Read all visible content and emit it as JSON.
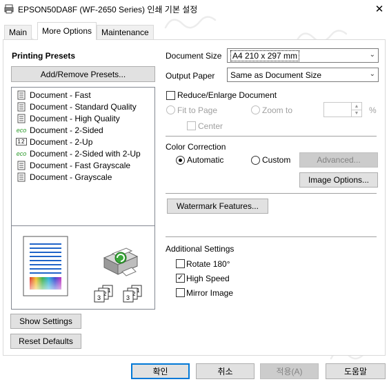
{
  "window": {
    "title": "EPSON50DA8F (WF-2650 Series) 인쇄 기본 설정",
    "close_glyph": "✕"
  },
  "tabs": [
    {
      "label": "Main",
      "active": false
    },
    {
      "label": "More Options",
      "active": true
    },
    {
      "label": "Maintenance",
      "active": false
    }
  ],
  "presets": {
    "heading": "Printing Presets",
    "add_remove_label": "Add/Remove Presets...",
    "items": [
      {
        "label": "Document - Fast",
        "icon": "document-icon"
      },
      {
        "label": "Document - Standard Quality",
        "icon": "document-icon"
      },
      {
        "label": "Document - High Quality",
        "icon": "document-icon"
      },
      {
        "label": "Document - 2-Sided",
        "icon": "eco-icon"
      },
      {
        "label": "Document - 2-Up",
        "icon": "two-up-icon"
      },
      {
        "label": "Document - 2-Sided with 2-Up",
        "icon": "eco-icon"
      },
      {
        "label": "Document - Fast Grayscale",
        "icon": "document-icon"
      },
      {
        "label": "Document - Grayscale",
        "icon": "document-icon"
      }
    ],
    "eco_text": "eco",
    "two_up_text": "12"
  },
  "left_buttons": {
    "show_settings": "Show Settings",
    "reset_defaults": "Reset Defaults"
  },
  "document_size": {
    "label": "Document Size",
    "value": "A4 210 x 297 mm"
  },
  "output_paper": {
    "label": "Output Paper",
    "value": "Same as Document Size"
  },
  "reduce_enlarge": {
    "label": "Reduce/Enlarge Document",
    "checked": false,
    "fit_to_page": "Fit to Page",
    "zoom_to": "Zoom to",
    "percent": "%",
    "center": "Center"
  },
  "color_correction": {
    "label": "Color Correction",
    "automatic": "Automatic",
    "custom": "Custom",
    "selected": "Automatic",
    "advanced": "Advanced...",
    "image_options": "Image Options..."
  },
  "watermark_features": "Watermark Features...",
  "additional_settings": {
    "label": "Additional Settings",
    "rotate": {
      "label": "Rotate 180°",
      "checked": false
    },
    "high_speed": {
      "label": "High Speed",
      "checked": true
    },
    "mirror": {
      "label": "Mirror Image",
      "checked": false
    }
  },
  "preview": {
    "sheet_labels": [
      "3",
      "2",
      "1"
    ]
  },
  "bottom_buttons": {
    "ok": "확인",
    "cancel": "취소",
    "apply": "적용(A)",
    "help": "도움말"
  },
  "colors": {
    "accent": "#0078d7",
    "doc_lines": "#1e63c8",
    "disabled_text": "#838383"
  }
}
